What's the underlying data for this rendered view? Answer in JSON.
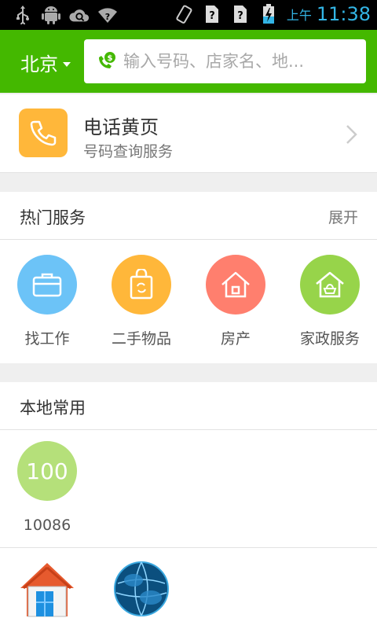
{
  "status_bar": {
    "ampm": "上午",
    "time": "11:38",
    "left_icons": [
      "usb-icon",
      "android-icon",
      "cloud-search-icon",
      "wifi-unknown-icon"
    ],
    "right_icons": [
      "vibrate-icon",
      "sim-unknown-icon",
      "sim-unknown-icon",
      "battery-charging-icon"
    ]
  },
  "header": {
    "city": "北京",
    "search_placeholder": "输入号码、店家名、地..."
  },
  "yellow_pages": {
    "title": "电话黄页",
    "subtitle": "号码查询服务"
  },
  "hot_services": {
    "title": "热门服务",
    "more": "展开",
    "items": [
      {
        "label": "找工作",
        "color": "#6cc3f7",
        "icon": "briefcase-icon"
      },
      {
        "label": "二手物品",
        "color": "#ffb73a",
        "icon": "shopping-bag-icon"
      },
      {
        "label": "房产",
        "color": "#ff7f6e",
        "icon": "house-icon"
      },
      {
        "label": "家政服务",
        "color": "#97d44a",
        "icon": "home-service-icon"
      }
    ]
  },
  "local": {
    "title": "本地常用",
    "items": [
      {
        "badge": "100",
        "label": "10086"
      }
    ],
    "apps": [
      "house-app-icon",
      "globe-app-icon"
    ]
  },
  "colors": {
    "brand_green": "#44b800",
    "accent_blue": "#33b5e5"
  }
}
